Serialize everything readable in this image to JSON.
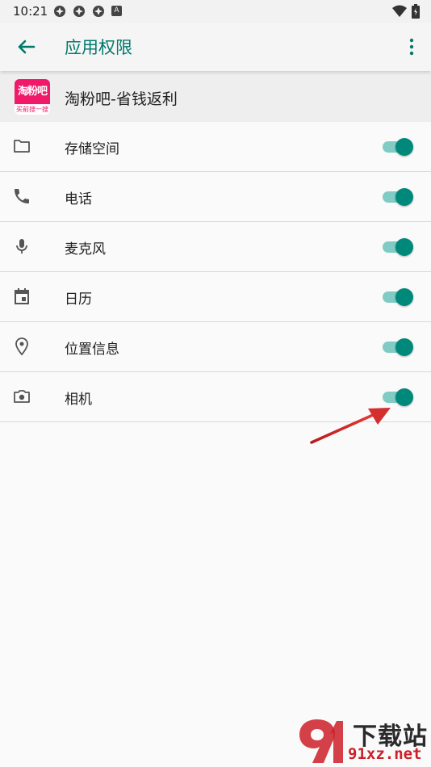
{
  "status_bar": {
    "time": "10:21",
    "notification_badge": "A"
  },
  "app_bar": {
    "title": "应用权限",
    "back_icon": "arrow-left-icon",
    "more_icon": "more-vertical-icon"
  },
  "app": {
    "name": "淘粉吧-省钱返利",
    "logo_text": "淘粉吧",
    "logo_subtext": "买前搜一搜",
    "brand_color": "#f0196a"
  },
  "permissions": [
    {
      "label": "存储空间",
      "icon": "folder-icon",
      "enabled": true
    },
    {
      "label": "电话",
      "icon": "phone-icon",
      "enabled": true
    },
    {
      "label": "麦克风",
      "icon": "microphone-icon",
      "enabled": true
    },
    {
      "label": "日历",
      "icon": "calendar-icon",
      "enabled": true
    },
    {
      "label": "位置信息",
      "icon": "location-pin-icon",
      "enabled": true
    },
    {
      "label": "相机",
      "icon": "camera-icon",
      "enabled": true
    }
  ],
  "colors": {
    "accent": "#00796b",
    "toggle_thumb": "#00897b",
    "toggle_track": "#80cbc4",
    "annotation_arrow": "#d32f2f"
  },
  "watermark": {
    "text": "下载站",
    "url": "91xz.net"
  }
}
